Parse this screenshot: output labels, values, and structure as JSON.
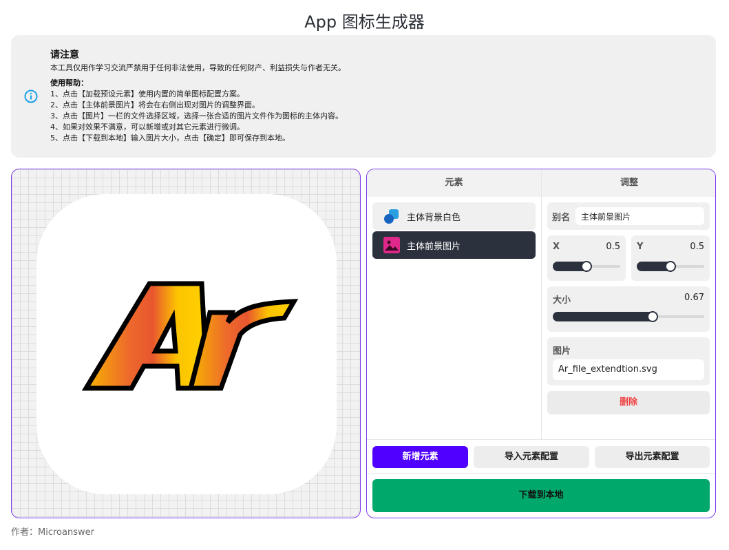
{
  "page": {
    "title": "App 图标生成器"
  },
  "notice": {
    "title": "请注意",
    "description": "本工具仅用作学习交流严禁用于任何非法使用，导致的任何财产、利益损失与作者无关。",
    "help_title": "使用帮助：",
    "steps": [
      "1、点击【加载预设元素】使用内置的简单图标配置方案。",
      "2、点击【主体前景图片】将会在右侧出现对图片的调整界面。",
      "3、点击【图片】一栏的文件选择区域，选择一张合适的图片文件作为图标的主体内容。",
      "4、如果对效果不满意，可以新增或对其它元素进行微调。",
      "5、点击【下载到本地】输入图片大小，点击【确定】即可保存到本地。"
    ],
    "icon": "info-circle-icon"
  },
  "preview": {
    "background_color": "#ffffff",
    "foreground_text": "Ar"
  },
  "elements": {
    "header": "元素",
    "items": [
      {
        "label": "主体背景白色",
        "icon": "shapes-icon",
        "active": false
      },
      {
        "label": "主体前景图片",
        "icon": "image-icon",
        "active": true
      }
    ]
  },
  "adjust": {
    "header": "调整",
    "alias_label": "别名",
    "alias_value": "主体前景图片",
    "x_label": "X",
    "x_value": "0.5",
    "y_label": "Y",
    "y_value": "0.5",
    "size_label": "大小",
    "size_value": "0.67",
    "image_label": "图片",
    "image_file": "Ar_file_extendtion.svg",
    "delete_label": "删除"
  },
  "actions": {
    "add_label": "新增元素",
    "import_label": "导入元素配置",
    "export_label": "导出元素配置",
    "download_label": "下载到本地"
  },
  "footer": {
    "author": "作者：Microanswer"
  },
  "colors": {
    "accent": "#4f00ff",
    "panel_border": "#7c3aed",
    "download": "#00a86b",
    "delete": "#ef4444",
    "active_item": "#2b313d"
  }
}
